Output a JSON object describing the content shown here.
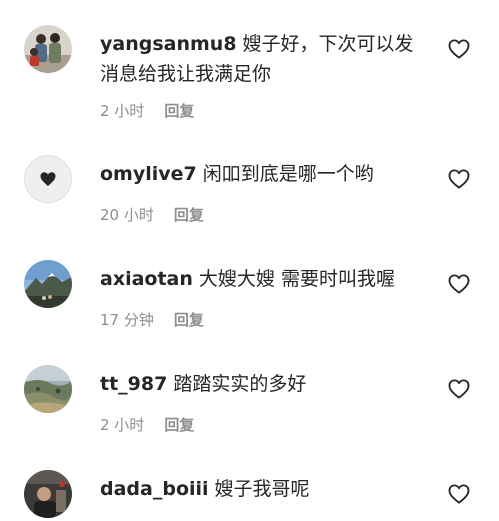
{
  "comments": [
    {
      "username": "yangsanmu8",
      "text": "嫂子好，下次可以发消息给我让我满足你",
      "time": "2 小时",
      "reply": "回复",
      "avatar": "family-photo-avatar"
    },
    {
      "username": "omylive7",
      "text": "闲吅到底是哪一个哟",
      "time": "20 小时",
      "reply": "回复",
      "avatar": "heart-logo-avatar"
    },
    {
      "username": "axiaotan",
      "text": "大嫂大嫂 需要时叫我喔",
      "time": "17 分钟",
      "reply": "回复",
      "avatar": "mountain-photo-avatar"
    },
    {
      "username": "tt_987",
      "text": "踏踏实实的多好",
      "time": "2 小时",
      "reply": "回复",
      "avatar": "landscape-photo-avatar"
    },
    {
      "username": "dada_boiii",
      "text": "嫂子我哥呢",
      "time": "",
      "reply": "",
      "avatar": "person-photo-avatar"
    }
  ],
  "colors": {
    "text": "#262626",
    "meta": "#8e8e8e",
    "background": "#ffffff"
  }
}
